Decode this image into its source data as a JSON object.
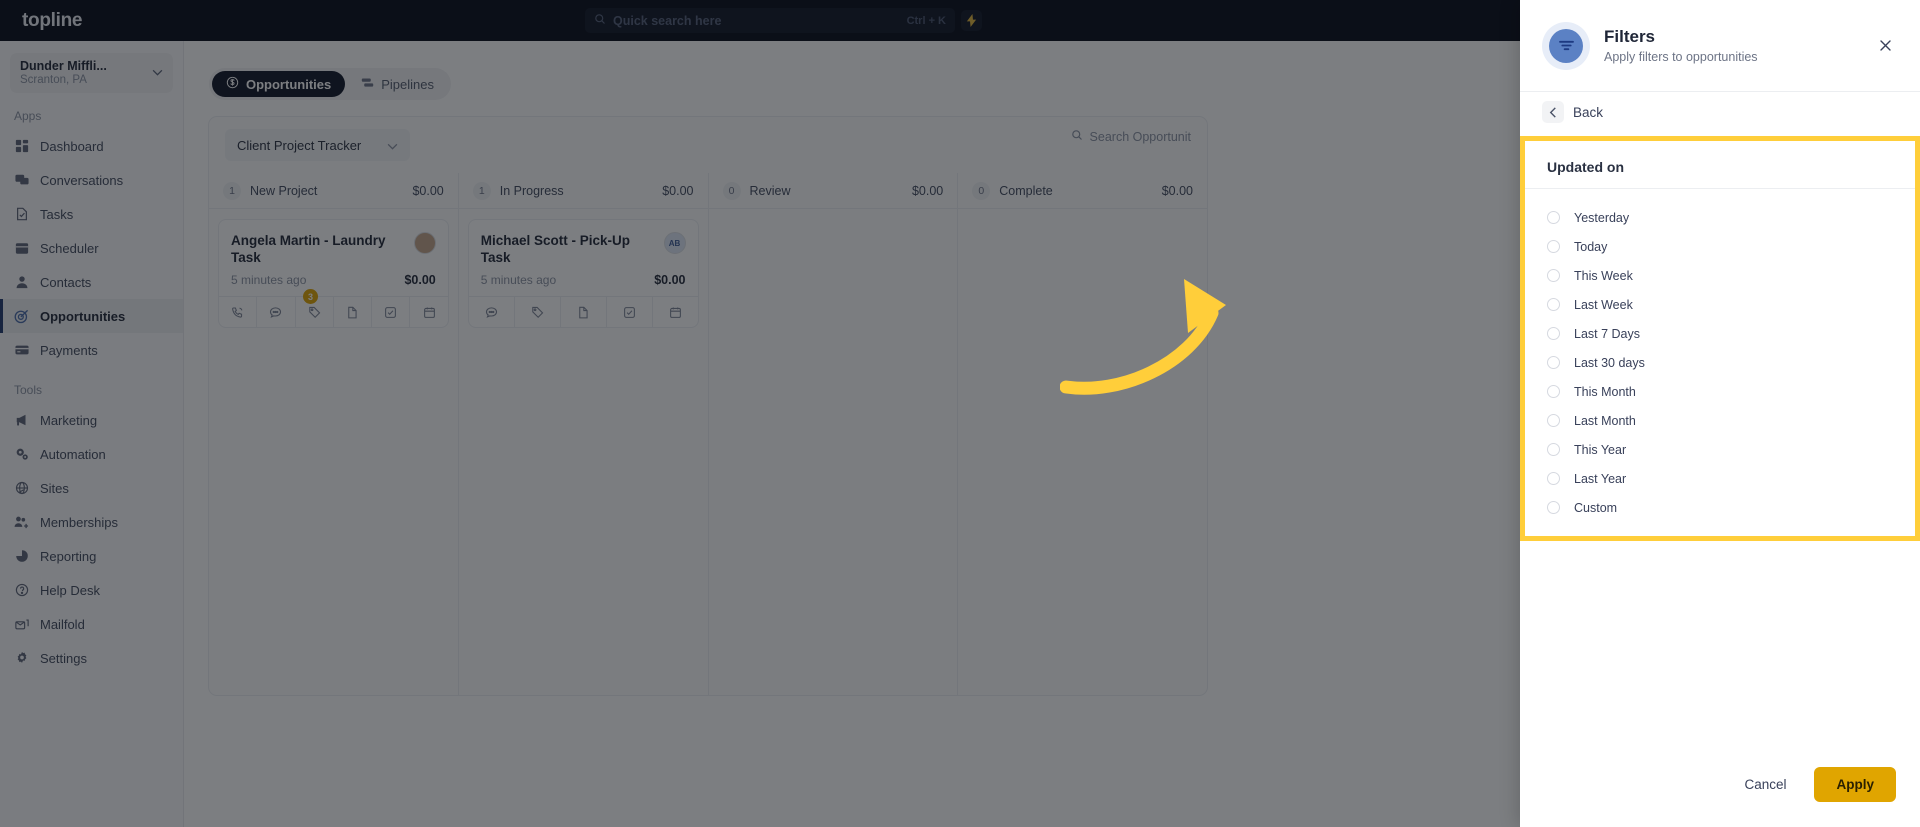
{
  "topbar": {
    "brand": "topline",
    "search_placeholder": "Quick search here",
    "shortcut": "Ctrl + K",
    "bolt_icon": "lightning-icon",
    "search_icon": "search-icon"
  },
  "sidebar": {
    "org_name": "Dunder Miffli...",
    "org_location": "Scranton, PA",
    "sections": [
      {
        "label": "Apps",
        "items": [
          {
            "label": "Dashboard",
            "icon": "dashboard-icon",
            "active": false
          },
          {
            "label": "Conversations",
            "icon": "chat-icon",
            "active": false
          },
          {
            "label": "Tasks",
            "icon": "task-icon",
            "active": false
          },
          {
            "label": "Scheduler",
            "icon": "calendar-icon",
            "active": false
          },
          {
            "label": "Contacts",
            "icon": "person-icon",
            "active": false
          },
          {
            "label": "Opportunities",
            "icon": "target-icon",
            "active": true
          },
          {
            "label": "Payments",
            "icon": "card-icon",
            "active": false
          }
        ]
      },
      {
        "label": "Tools",
        "items": [
          {
            "label": "Marketing",
            "icon": "megaphone-icon",
            "active": false
          },
          {
            "label": "Automation",
            "icon": "gears-icon",
            "active": false
          },
          {
            "label": "Sites",
            "icon": "globe-icon",
            "active": false
          },
          {
            "label": "Memberships",
            "icon": "people-add-icon",
            "active": false
          },
          {
            "label": "Reporting",
            "icon": "pie-chart-icon",
            "active": false
          },
          {
            "label": "Help Desk",
            "icon": "question-circle-icon",
            "active": false
          },
          {
            "label": "Mailfold",
            "icon": "mail-stack-icon",
            "active": false
          },
          {
            "label": "Settings",
            "icon": "gear-icon",
            "active": false
          }
        ]
      }
    ]
  },
  "main": {
    "tabs": [
      {
        "label": "Opportunities",
        "icon": "dollar-circle-icon",
        "active": true
      },
      {
        "label": "Pipelines",
        "icon": "pipeline-icon",
        "active": false
      }
    ],
    "pipeline_selected": "Client Project Tracker",
    "board_search_placeholder": "Search Opportunit",
    "columns": [
      {
        "count": "1",
        "title": "New Project",
        "total": "$0.00",
        "cards": [
          {
            "title": "Angela Martin - Laundry Task",
            "time": "5 minutes ago",
            "amount": "$0.00",
            "avatar_initials": "",
            "badge": "3",
            "actions": [
              "phone-icon",
              "message-icon",
              "tag-icon",
              "document-icon",
              "check-square-icon",
              "calendar-icon"
            ]
          }
        ]
      },
      {
        "count": "1",
        "title": "In Progress",
        "total": "$0.00",
        "cards": [
          {
            "title": "Michael Scott - Pick-Up Task",
            "time": "5 minutes ago",
            "amount": "$0.00",
            "avatar_initials": "AB",
            "badge": "",
            "actions": [
              "message-icon",
              "tag-icon",
              "document-icon",
              "check-square-icon",
              "calendar-icon"
            ]
          }
        ]
      },
      {
        "count": "0",
        "title": "Review",
        "total": "$0.00",
        "cards": []
      },
      {
        "count": "0",
        "title": "Complete",
        "total": "$0.00",
        "cards": []
      }
    ]
  },
  "drawer": {
    "icon": "filter-icon",
    "title": "Filters",
    "subtitle": "Apply filters to opportunities",
    "close_icon": "close-icon",
    "back_label": "Back",
    "back_icon": "chevron-left-icon",
    "filter_group_title": "Updated on",
    "options": [
      "Yesterday",
      "Today",
      "This Week",
      "Last Week",
      "Last 7 Days",
      "Last 30 days",
      "This Month",
      "Last Month",
      "This Year",
      "Last Year",
      "Custom"
    ],
    "cancel_label": "Cancel",
    "apply_label": "Apply"
  },
  "annotation": {
    "arrow_color": "#ffce3a",
    "highlight_color": "#ffce3a"
  }
}
